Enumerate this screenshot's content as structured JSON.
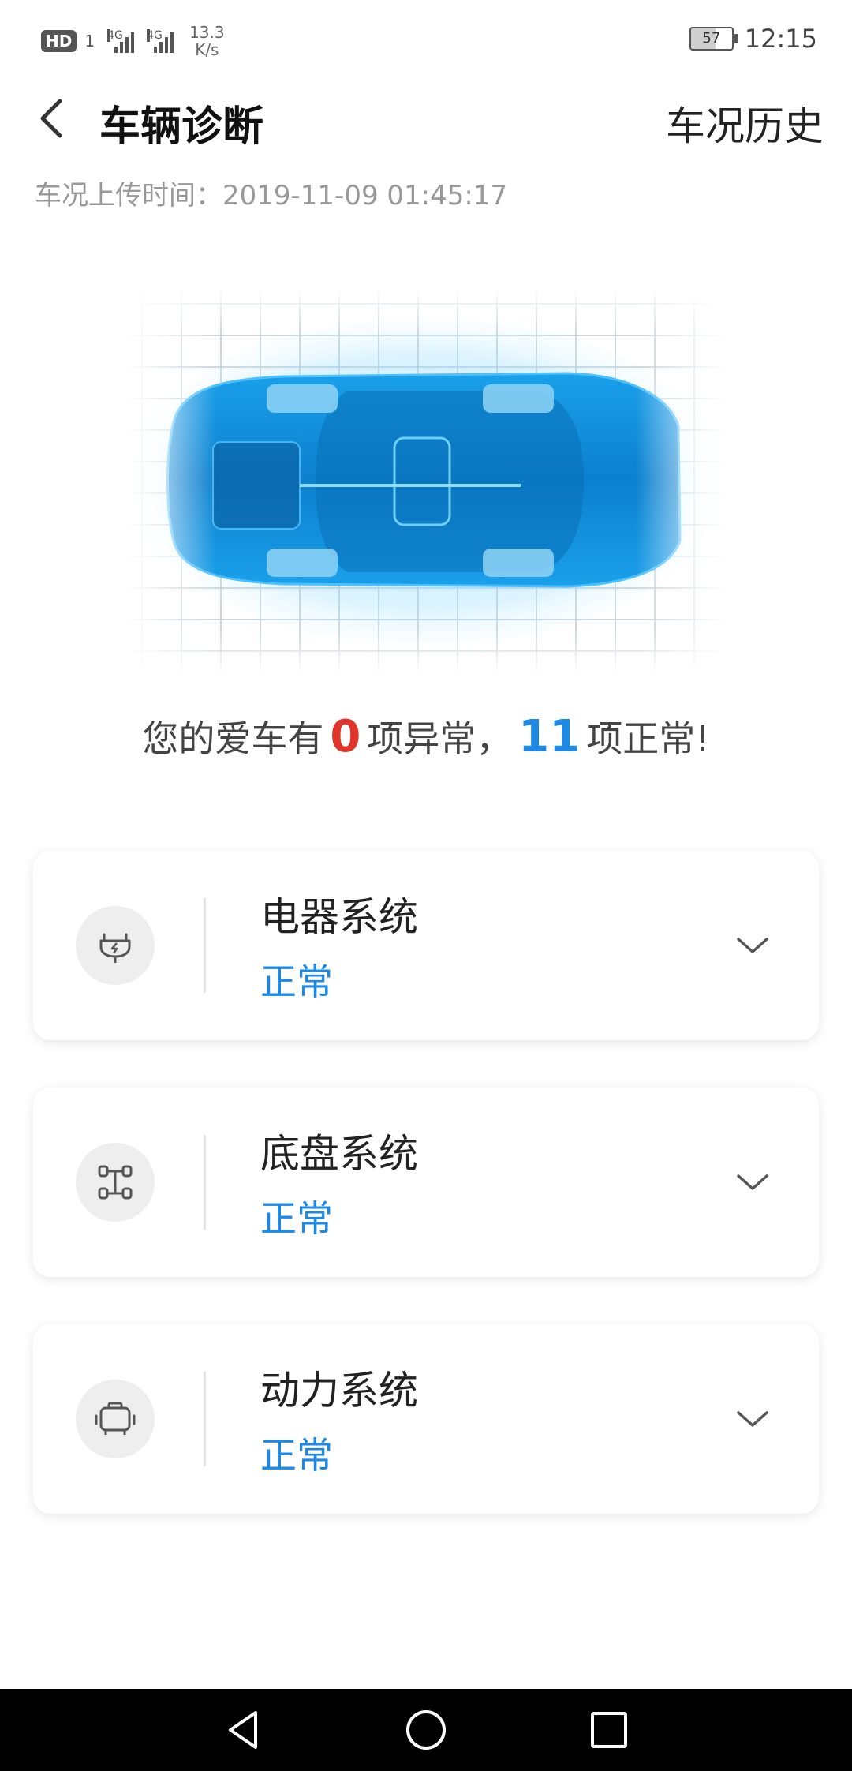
{
  "status_bar": {
    "hd": "HD",
    "hd_sub": "1",
    "sig1_label": "4G",
    "sig2_label": "4G",
    "net_speed": "13.3",
    "net_unit": "K/s",
    "battery": "57",
    "time": "12:15"
  },
  "header": {
    "title": "车辆诊断",
    "history": "车况历史"
  },
  "upload_time": "车况上传时间：2019-11-09 01:45:17",
  "summary": {
    "prefix": "您的爱车有",
    "abnormal": "0",
    "middle": "项异常，",
    "normal": "11",
    "suffix": "项正常!"
  },
  "systems": [
    {
      "name": "电器系统",
      "status": "正常",
      "icon": "plug-icon"
    },
    {
      "name": "底盘系统",
      "status": "正常",
      "icon": "chassis-icon"
    },
    {
      "name": "动力系统",
      "status": "正常",
      "icon": "engine-icon"
    }
  ],
  "colors": {
    "accent_blue": "#1e88e5",
    "warning_red": "#e0352b",
    "car_blue": "#1a9be6"
  }
}
